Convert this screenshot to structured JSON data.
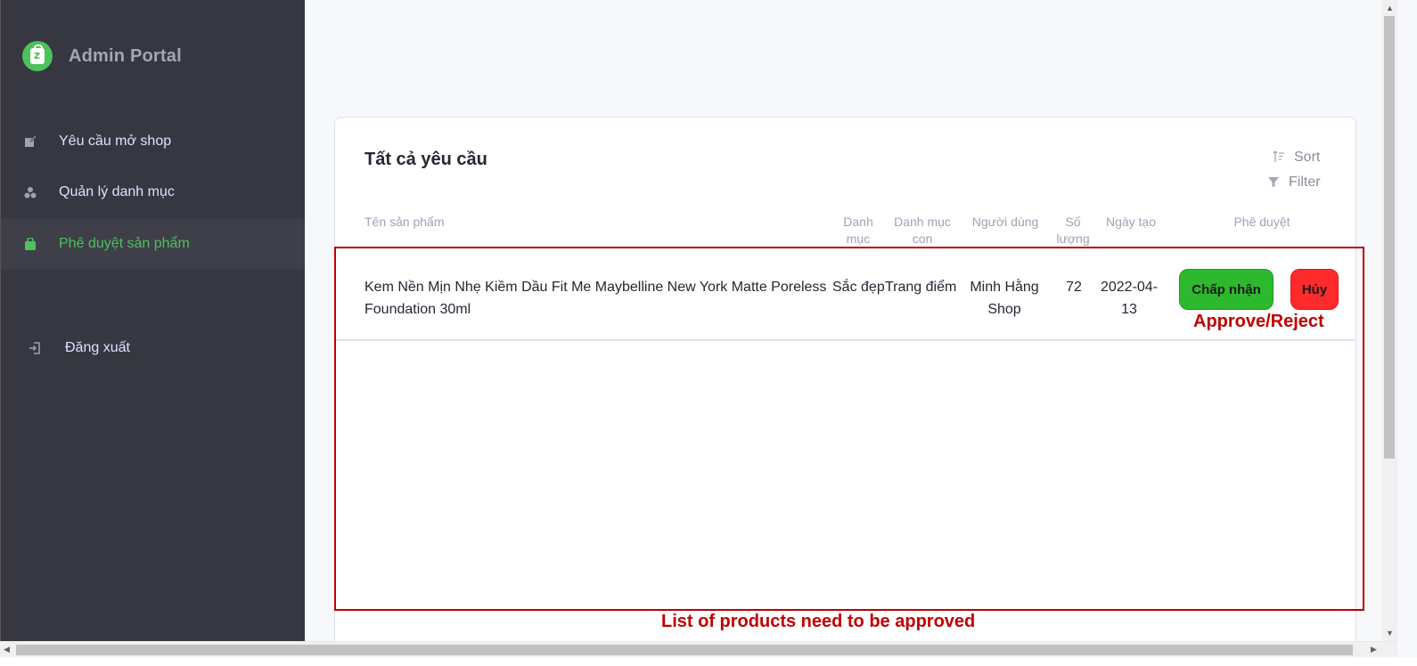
{
  "brand": {
    "name": "Admin Portal",
    "logo_icon": "shopping-bag-icon",
    "logo_color": "#4cc25a"
  },
  "sidebar": {
    "items": [
      {
        "label": "Yêu cầu mở shop",
        "icon": "edit-square-icon",
        "active": false
      },
      {
        "label": "Quản lý danh mục",
        "icon": "shapes-icon",
        "active": false
      },
      {
        "label": "Phê duyệt sản phẩm",
        "icon": "bag-icon",
        "active": true
      },
      {
        "label": "Đăng xuất",
        "icon": "logout-icon",
        "active": false
      }
    ]
  },
  "card": {
    "title": "Tất cả yêu cầu",
    "sort_label": "Sort",
    "filter_label": "Filter"
  },
  "table": {
    "headers": {
      "name": "Tên sản phẩm",
      "category": "Danh mục",
      "subcategory": "Danh mục con",
      "user": "Người dùng",
      "quantity": "Số lượng",
      "created": "Ngày tạo",
      "approve": "Phê duyệt"
    },
    "rows": [
      {
        "name": "Kem Nền Mịn Nhẹ Kiềm Dầu Fit Me Maybelline New York Matte Poreless Foundation 30ml",
        "category": "Sắc đẹp",
        "subcategory": "Trang điểm",
        "user": "Minh Hằng Shop",
        "quantity": "72",
        "created": "2022-04-13",
        "accept_label": "Chấp nhận",
        "reject_label": "Hủy"
      }
    ]
  },
  "annotations": {
    "approve_reject": "Approve/Reject",
    "list_note": "List of products need to be approved"
  },
  "colors": {
    "accent": "#4cc25a",
    "accept": "#2db92d",
    "reject": "#ff2a2a",
    "annotation": "#c00000",
    "sidebar_bg": "#363740"
  }
}
